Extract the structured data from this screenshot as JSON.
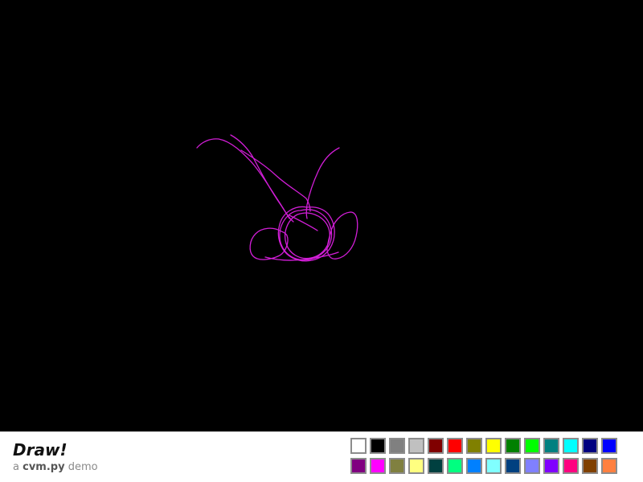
{
  "app": {
    "title": "Draw!",
    "subtitle_prefix": "a ",
    "subtitle_name": "cvm.py",
    "subtitle_suffix": " demo"
  },
  "canvas": {
    "background": "#000000",
    "stroke_color": "#d21ed7"
  },
  "palette": {
    "colors": [
      "#ffffff",
      "#000000",
      "#808080",
      "#c0c0c0",
      "#800000",
      "#ff0000",
      "#808000",
      "#ffff00",
      "#008000",
      "#00ff00",
      "#008080",
      "#00ffff",
      "#000080",
      "#0000ff",
      "#800080",
      "#ff00ff",
      "#808040",
      "#ffff80",
      "#004040",
      "#00ff80",
      "#0080ff",
      "#80ffff",
      "#004080",
      "#8080ff",
      "#8000ff",
      "#ff0080",
      "#804000",
      "#ff8040"
    ]
  }
}
